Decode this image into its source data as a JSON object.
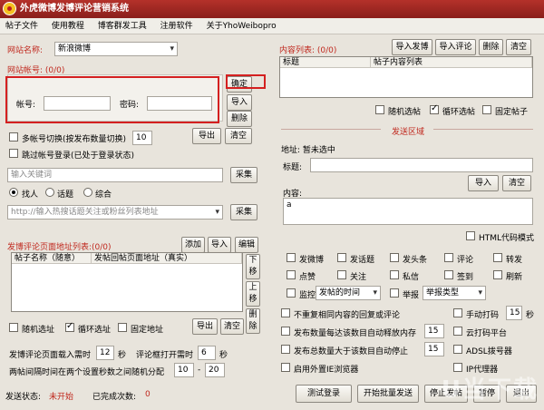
{
  "window": {
    "title": "外虎微博发博评论营销系统"
  },
  "menu": [
    "帖子文件",
    "使用教程",
    "博客群发工具",
    "注册软件",
    "关于YhoWeibopro"
  ],
  "site": {
    "label": "网站名称:",
    "value": "新浪微博",
    "accounts_label": "网站帐号: (0/0)"
  },
  "account": {
    "user_label": "帐号:",
    "pass_label": "密码:",
    "confirm": "确定",
    "import": "导入",
    "delete": "删除",
    "export": "导出",
    "clear": "清空"
  },
  "options": {
    "multi_switch": "多帐号切换(按发布数量切换)",
    "multi_value": "10",
    "skip_login": "跳过帐号登录(已处于登录状态)"
  },
  "keyword": {
    "placeholder": "输入关键词",
    "collect": "采集",
    "radios": [
      "找人",
      "话题",
      "综合"
    ],
    "url_placeholder": "http://输入热搜话题关注或粉丝列表地址",
    "collect2": "采集"
  },
  "urllist": {
    "title": "发博评论页面地址列表:(0/0)",
    "add": "添加",
    "import": "导入",
    "edit": "编辑",
    "col1": "帖子名称（随意）",
    "col2": "发帖回帖页面地址（真实）",
    "down": "下移",
    "up": "上移",
    "delete": "删除",
    "random": "随机选址",
    "loop": "循环选址",
    "fixed": "固定地址",
    "export": "导出",
    "clear": "清空"
  },
  "timing": {
    "load_label": "发博评论页面载入需时",
    "load_val": "12",
    "sec": "秒",
    "comment_label": "评论框打开需时",
    "comment_val": "6",
    "sec2": "秒",
    "interval_label": "两帖间隔时间在两个设置秒数之间随机分配",
    "min": "10",
    "dash": "-",
    "max": "20"
  },
  "status": {
    "label": "发送状态:",
    "value": "未开始",
    "done_label": "已完成次数:",
    "done_value": "0"
  },
  "content": {
    "title": "内容列表: (0/0)",
    "import_post": "导入发博",
    "import_comment": "导入评论",
    "delete": "删除",
    "clear": "清空",
    "col1": "标题",
    "col2": "帖子内容列表",
    "random": "随机选帖",
    "loop": "循环选帖",
    "fixed": "固定帖子"
  },
  "send": {
    "title": "发送区域",
    "topic": "地址: 暂未选中",
    "title_label": "标题:",
    "import": "导入",
    "clear": "清空",
    "content_label": "内容:",
    "content_text": "a",
    "html_mode": "HTML代码模式"
  },
  "checks": [
    "发微博",
    "发话题",
    "发头条",
    "评论",
    "转发",
    "点赞",
    "关注",
    "私信",
    "签到",
    "刷新"
  ],
  "monitor": {
    "label": "监控",
    "sel": "发帖的时间",
    "report": "举报",
    "report_sel": "举报类型"
  },
  "adv": [
    {
      "label": "不重复相同内容的回复或评论"
    },
    {
      "label": "发布数量每达该数目自动释放内存",
      "val": "15"
    },
    {
      "label": "发布总数量大于该数目自动停止",
      "val": "15"
    },
    {
      "label": "启用外置IE浏览器"
    }
  ],
  "right_opts": [
    {
      "label": "手动打码",
      "val": "15",
      "unit": "秒"
    },
    {
      "label": "云打码平台"
    },
    {
      "label": "ADSL拨号器"
    },
    {
      "label": "IP代理器"
    }
  ],
  "buttons": {
    "test_login": "测试登录",
    "start": "开始批量发送",
    "stop": "停止发帖",
    "pause": "暂停",
    "exit": "退出"
  },
  "watermark": "U当下载"
}
